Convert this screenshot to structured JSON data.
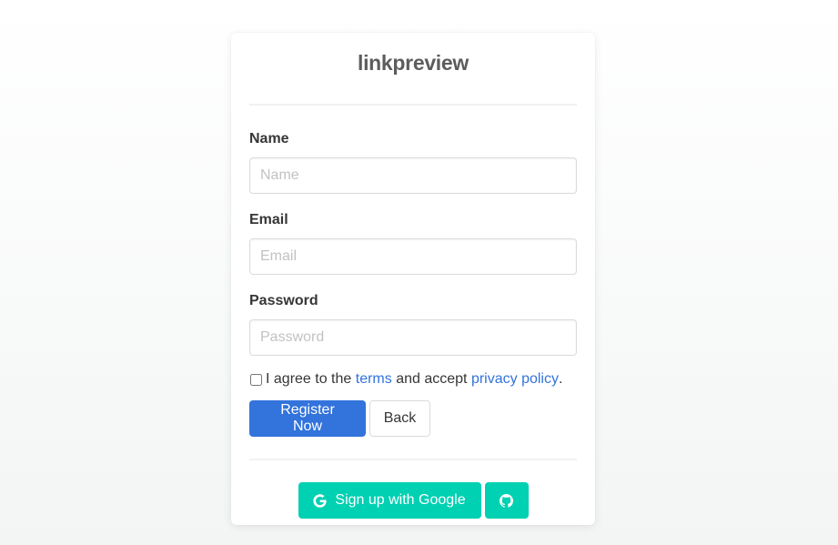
{
  "brand": {
    "title": "linkpreview"
  },
  "form": {
    "name": {
      "label": "Name",
      "placeholder": "Name"
    },
    "email": {
      "label": "Email",
      "placeholder": "Email"
    },
    "password": {
      "label": "Password",
      "placeholder": "Password"
    },
    "agreement": {
      "prefix": "I agree to the",
      "terms_link": "terms",
      "middle": "and accept",
      "privacy_link": "privacy policy",
      "suffix": ".",
      "checked": false
    },
    "register_label": "Register Now",
    "back_label": "Back"
  },
  "social": {
    "google_label": "Sign up with Google",
    "google_icon": "google-icon",
    "github_icon": "github-icon"
  },
  "colors": {
    "primary": "#3273dc",
    "social": "#00d1b2",
    "link": "#3273dc",
    "brand_text": "#5c5c5c"
  }
}
